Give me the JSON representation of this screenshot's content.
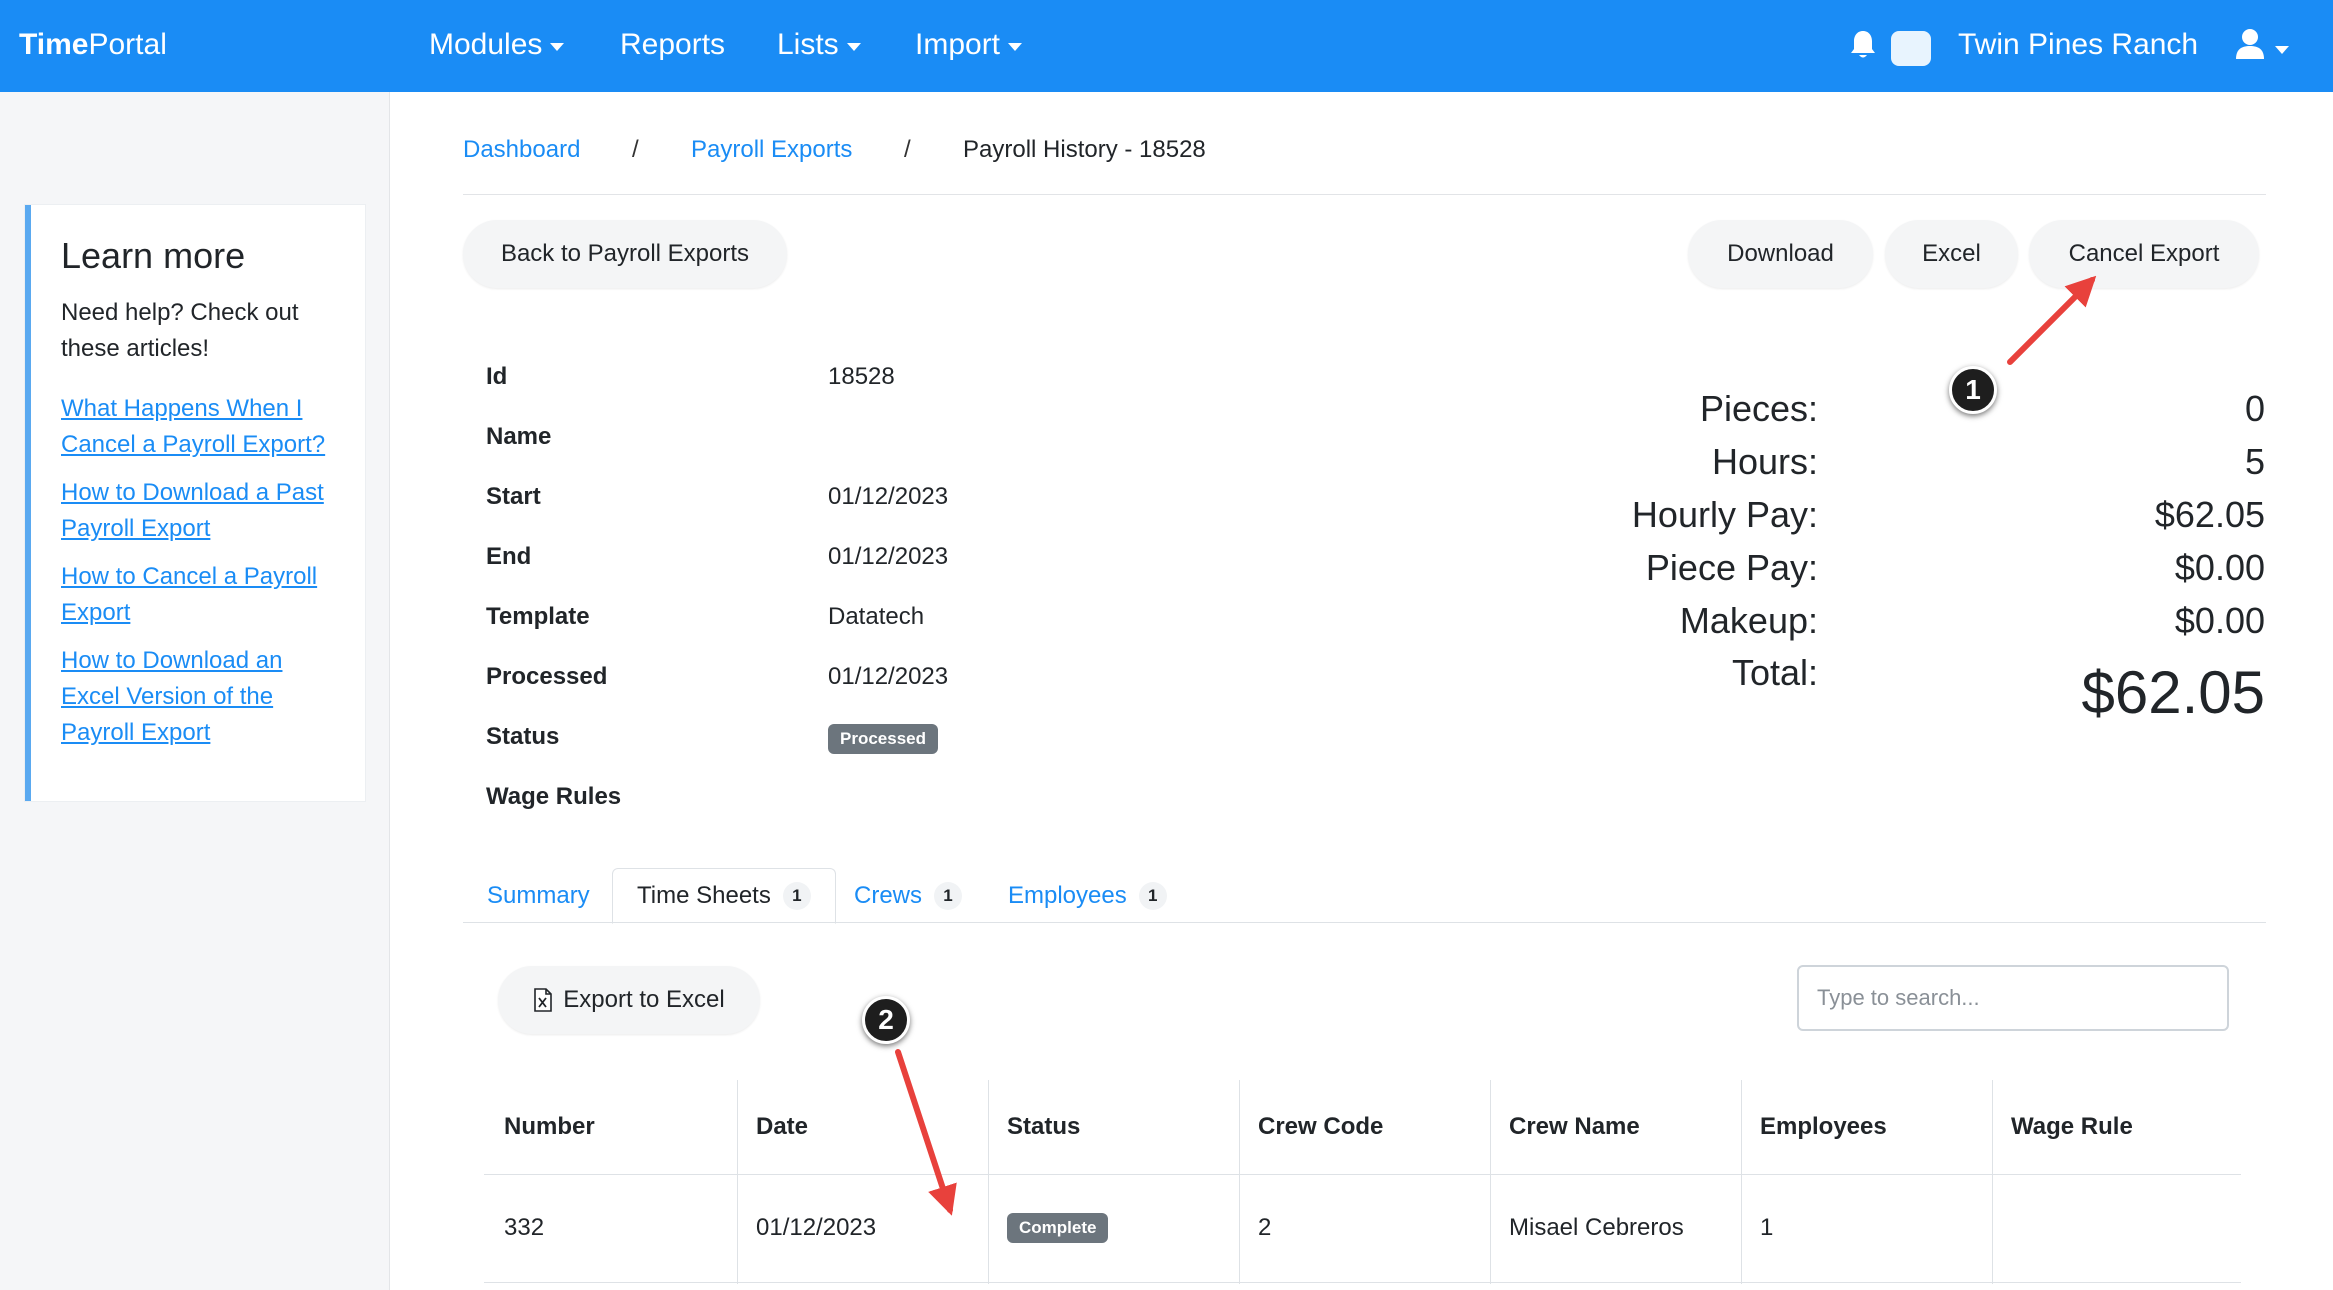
{
  "app": {
    "brand_bold": "Time",
    "brand_light": "Portal"
  },
  "nav": {
    "modules": "Modules",
    "reports": "Reports",
    "lists": "Lists",
    "import": "Import",
    "org_name": "Twin Pines Ranch"
  },
  "sidebar": {
    "title": "Learn more",
    "subtitle": "Need help? Check out these articles!",
    "links": [
      "What Happens When I Cancel a Payroll Export?",
      "How to Download a Past Payroll Export",
      "How to Cancel a Payroll Export",
      "How to Download an Excel Version of the Payroll Export"
    ]
  },
  "breadcrumb": {
    "dashboard": "Dashboard",
    "payroll_exports": "Payroll Exports",
    "separator": "/",
    "current": "Payroll History - 18528"
  },
  "actions": {
    "back": "Back to Payroll Exports",
    "download": "Download",
    "excel": "Excel",
    "cancel_export": "Cancel Export"
  },
  "details": {
    "id_label": "Id",
    "id_value": "18528",
    "name_label": "Name",
    "start_label": "Start",
    "start_value": "01/12/2023",
    "end_label": "End",
    "end_value": "01/12/2023",
    "template_label": "Template",
    "template_value": "Datatech",
    "processed_label": "Processed",
    "processed_value": "01/12/2023",
    "status_label": "Status",
    "status_value": "Processed",
    "wage_rules_label": "Wage Rules"
  },
  "totals": {
    "pieces_label": "Pieces:",
    "pieces_value": "0",
    "hours_label": "Hours:",
    "hours_value": "5",
    "hourly_pay_label": "Hourly Pay:",
    "hourly_pay_value": "$62.05",
    "piece_pay_label": "Piece Pay:",
    "piece_pay_value": "$0.00",
    "makeup_label": "Makeup:",
    "makeup_value": "$0.00",
    "total_label": "Total:",
    "total_value": "$62.05"
  },
  "annotations": {
    "marker_1": "1",
    "marker_2": "2",
    "arrow_color": "#e8413c"
  },
  "tabs": [
    {
      "label": "Summary",
      "count": ""
    },
    {
      "label": "Time Sheets",
      "count": "1"
    },
    {
      "label": "Crews",
      "count": "1"
    },
    {
      "label": "Employees",
      "count": "1"
    }
  ],
  "toolbar": {
    "export_to_excel": "Export to Excel",
    "search_placeholder": "Type to search..."
  },
  "table": {
    "headers": [
      "Number",
      "Date",
      "Status",
      "Crew Code",
      "Crew Name",
      "Employees",
      "Wage Rule"
    ],
    "rows": [
      {
        "number": "332",
        "date": "01/12/2023",
        "status": "Complete",
        "crew_code": "2",
        "crew_name": "Misael Cebreros",
        "employees": "1",
        "wage_rule": ""
      }
    ]
  },
  "colors": {
    "brand_blue": "#1a8cf5",
    "badge_gray": "#6c757d",
    "sidebar_accent": "#5aa9f0"
  }
}
